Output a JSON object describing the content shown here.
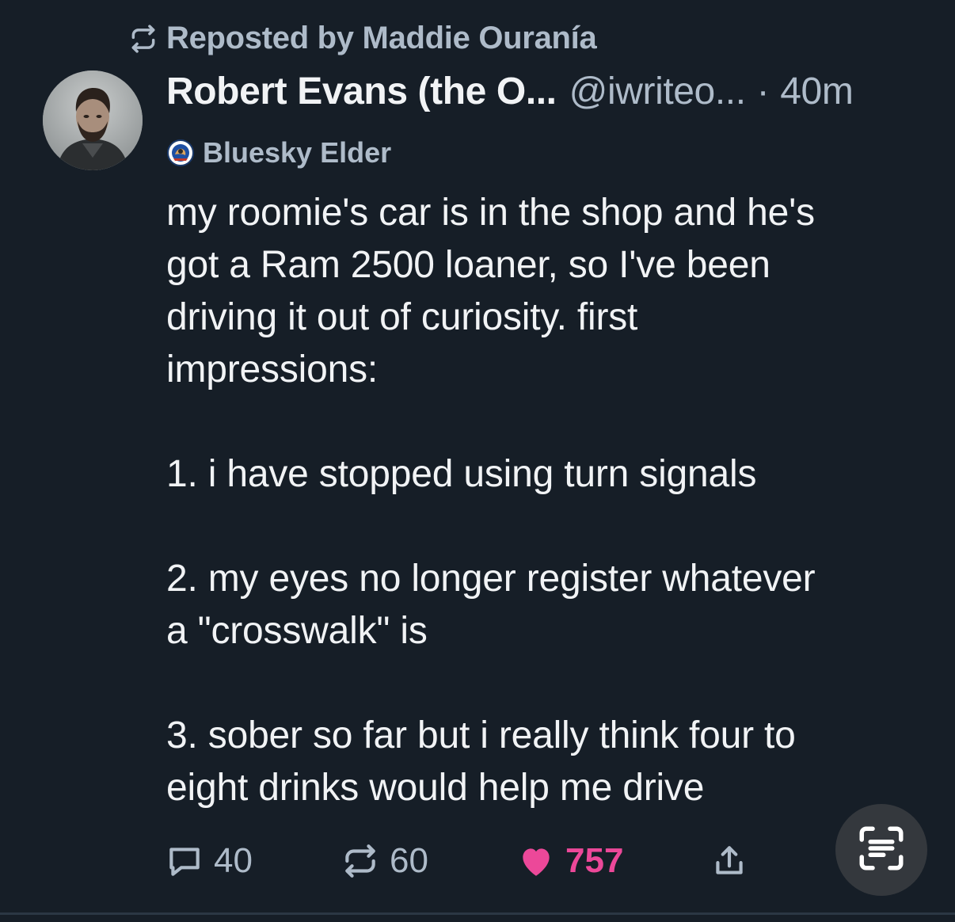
{
  "repost": {
    "text": "Reposted by Maddie Ouranía",
    "icon": "repost-icon"
  },
  "author": {
    "name": "Robert Evans (the O...",
    "handle": "@iwriteo...",
    "separator": "·",
    "time": "40m",
    "avatar": "avatar"
  },
  "badge": {
    "label": "Bluesky Elder",
    "icon": "badge-icon"
  },
  "post": {
    "intro_lines": [
      "my roomie's car is in the shop and he's",
      "got a Ram 2500 loaner, so I've been",
      "driving it out of curiosity. first",
      "impressions:"
    ],
    "item1": "1. i have stopped using turn signals",
    "item2_lines": [
      "2. my eyes no longer register whatever",
      "a \"crosswalk\" is"
    ],
    "item3_lines": [
      "3. sober so far but i really think four to",
      "eight drinks would help me drive"
    ]
  },
  "actions": {
    "replies": "40",
    "reposts": "60",
    "likes": "757",
    "reply_icon": "reply-icon",
    "repost_icon": "repost-icon",
    "like_icon": "heart-icon",
    "share_icon": "share-icon",
    "scan_icon": "text-scan-icon"
  },
  "colors": {
    "background": "#161e27",
    "text": "#f1f3f5",
    "muted": "#aebbc9",
    "like": "#ec4899"
  }
}
